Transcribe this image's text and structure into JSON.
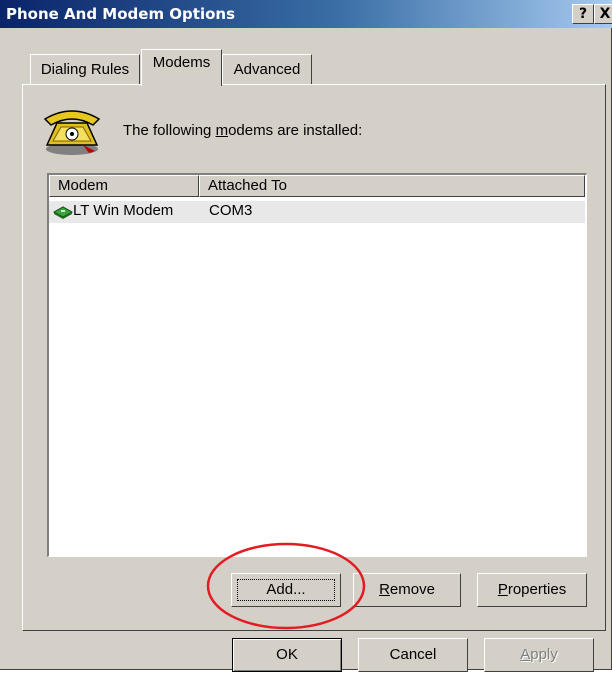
{
  "window": {
    "title": "Phone And Modem Options",
    "help_glyph": "?",
    "close_glyph": "X"
  },
  "tabs": [
    {
      "label": "Dialing Rules",
      "active": false
    },
    {
      "label": "Modems",
      "active": true
    },
    {
      "label": "Advanced",
      "active": false
    }
  ],
  "modems_panel": {
    "info": {
      "before": "The following ",
      "accel": "m",
      "after": "odems are  installed:"
    },
    "icon": "telephone-icon",
    "list": {
      "columns": [
        "Modem",
        "Attached To"
      ],
      "rows": [
        {
          "icon": "modem-icon",
          "modem": "LT Win Modem",
          "attached_to": "COM3",
          "selected": true
        }
      ]
    },
    "buttons": {
      "add": "Add...",
      "remove": {
        "accel": "R",
        "rest": "emove"
      },
      "properties": {
        "accel": "P",
        "rest": "roperties"
      }
    },
    "annotation_color": "#e31b23"
  },
  "dialog_buttons": {
    "ok": "OK",
    "cancel": "Cancel",
    "apply": {
      "accel": "A",
      "rest": "pply",
      "disabled": true
    }
  }
}
